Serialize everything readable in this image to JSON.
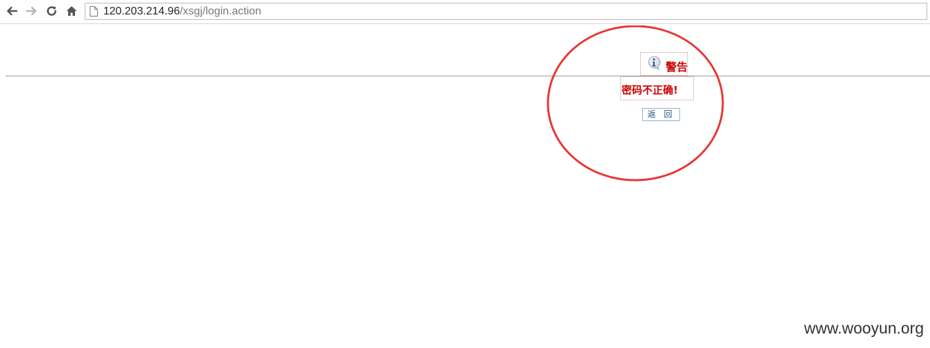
{
  "browser": {
    "url_host": "120.203.214.96",
    "url_path": "/xsgj/login.action",
    "icons": [
      "back-arrow-icon",
      "forward-arrow-icon",
      "reload-icon",
      "home-icon",
      "page-icon"
    ]
  },
  "alert": {
    "title": "警告",
    "message": "密码不正确!",
    "back_label": "返 回",
    "icon": "info-icon",
    "text_color": "#cc0000"
  },
  "annotation": {
    "circle_color": "#e53935"
  },
  "watermark": "www.wooyun.org"
}
